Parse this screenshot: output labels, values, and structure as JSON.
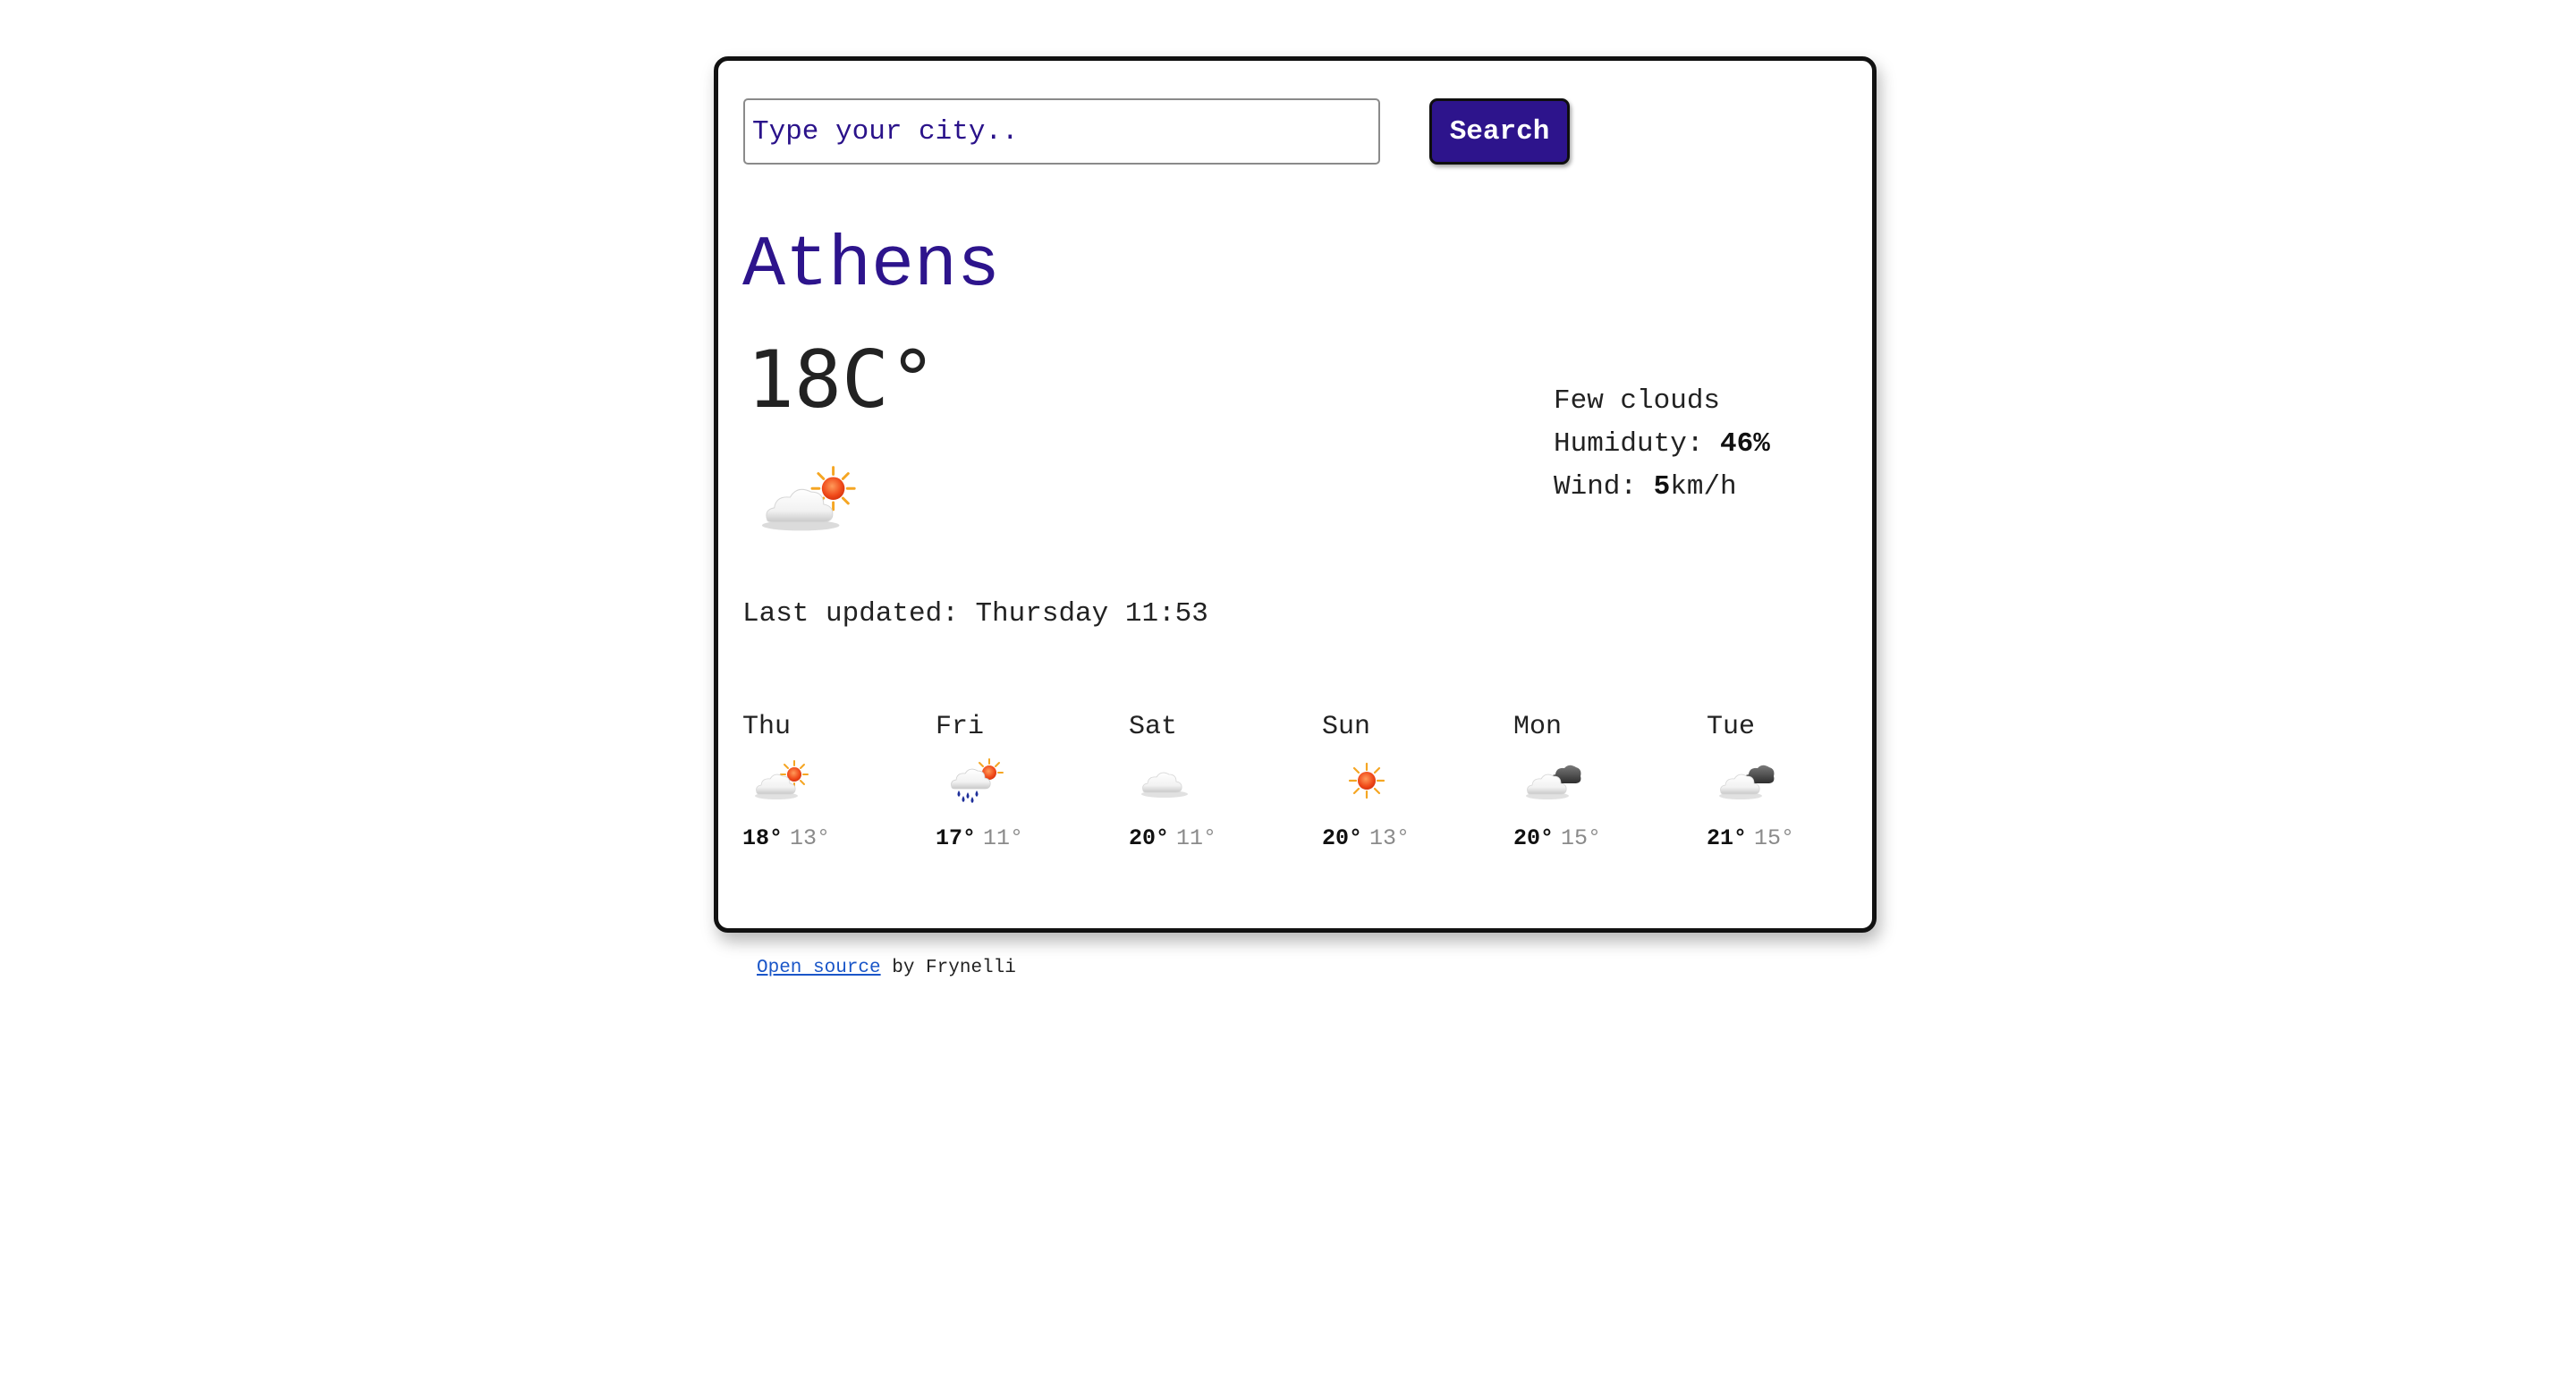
{
  "search": {
    "placeholder": "Type your city..",
    "button_label": "Search"
  },
  "current": {
    "city": "Athens",
    "temperature": "18C°",
    "icon": "few-clouds-day-icon",
    "description": "Few clouds",
    "humidity_label": "Humiduty: ",
    "humidity_value": "46",
    "humidity_unit": "%",
    "wind_label": "Wind: ",
    "wind_value": "5",
    "wind_unit": "km/h",
    "last_updated": "Last updated: Thursday 11:53"
  },
  "forecast": [
    {
      "day": "Thu",
      "icon": "few-clouds-day-icon",
      "max": "18°",
      "min": "13°"
    },
    {
      "day": "Fri",
      "icon": "rain-day-icon",
      "max": "17°",
      "min": "11°"
    },
    {
      "day": "Sat",
      "icon": "cloud-icon",
      "max": "20°",
      "min": "11°"
    },
    {
      "day": "Sun",
      "icon": "sun-icon",
      "max": "20°",
      "min": "13°"
    },
    {
      "day": "Mon",
      "icon": "broken-clouds-icon",
      "max": "20°",
      "min": "15°"
    },
    {
      "day": "Tue",
      "icon": "broken-clouds-icon",
      "max": "21°",
      "min": "15°"
    }
  ],
  "footer": {
    "link_text": "Open source",
    "suffix": " by Frynelli"
  },
  "colors": {
    "accent": "#2d148c",
    "link": "#1a56c8",
    "min_temp": "#8a8a8a"
  }
}
